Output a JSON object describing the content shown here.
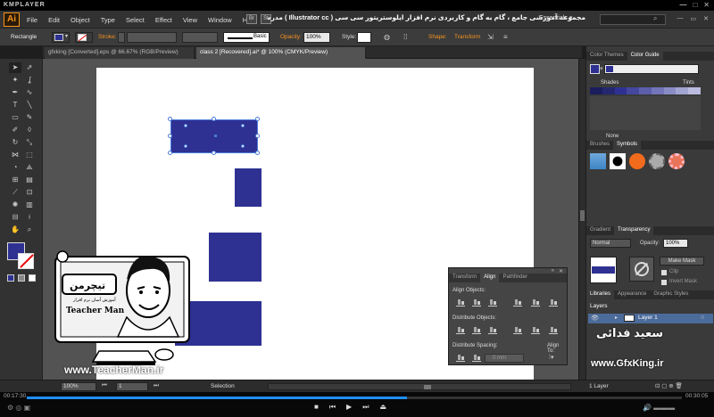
{
  "player": {
    "brand": "KMPLAYER",
    "time_current": "00:17:30",
    "time_total": "00:30:05",
    "progress": 0.58
  },
  "app": {
    "logo": "Ai",
    "menu": [
      "File",
      "Edit",
      "Object",
      "Type",
      "Select",
      "Effect",
      "View",
      "Window",
      "Help"
    ],
    "menu_icons": [
      "Br",
      "St"
    ]
  },
  "course_title": "مجموعه آموزشی جامع ، گام به گام و کاربردی نرم افزار ایلوستریتور سی سی ( Illustrator cc )  مدرس : سعید فدایی ( تیچرمن ) گروه آموزشی پادشاه گرافیست ها",
  "workspace": "Essentials",
  "control": {
    "object_type": "Rectangle",
    "stroke_label": "Stroke:",
    "brush": "Basic",
    "opacity_label": "Opacity:",
    "opacity_value": "100%",
    "style_label": "Style:",
    "shape_label": "Shape:",
    "transform_label": "Transform"
  },
  "colors": {
    "fill": "#2e3192",
    "accent": "#f7931e",
    "selection": "#4a7bd8"
  },
  "doc_tabs": [
    {
      "label": "gfxking [Converted].eps @ 66.67% (RGB/Preview)"
    },
    {
      "label": "class 2 [Recovered].ai* @ 100% (CMYK/Preview)"
    }
  ],
  "color_panel": {
    "tabs": [
      "Color Themes",
      "Color Guide"
    ],
    "shades_label": "Shades",
    "tints_label": "Tints",
    "none_label": "None",
    "shade_colors": [
      "#1b1d5c",
      "#24276f",
      "#2e3192",
      "#44479e",
      "#5b5eab",
      "#7275b8",
      "#8a8cc5",
      "#a2a4d2",
      "#babbdf"
    ]
  },
  "symbols_panel": {
    "tabs": [
      "Brushes",
      "Symbols"
    ]
  },
  "transparency_panel": {
    "tabs": [
      "Gradient",
      "Transparency"
    ],
    "blend_mode": "Normal",
    "opacity_label": "Opacity:",
    "opacity_value": "100%",
    "make_mask": "Make Mask",
    "clip": "Clip",
    "invert_mask": "Invert Mask"
  },
  "layers_panel": {
    "tabs": [
      "Libraries",
      "Appearance",
      "Graphic Styles"
    ],
    "title": "Layers",
    "layer_name": "Layer 1",
    "layer_count": "1 Layer"
  },
  "align_panel": {
    "tabs": [
      "Transform",
      "Align",
      "Pathfinder"
    ],
    "align_objects": "Align Objects:",
    "distribute_objects": "Distribute Objects:",
    "distribute_spacing": "Distribute Spacing:",
    "align_to": "Align To:",
    "spacing_value": "0 mm"
  },
  "status": {
    "zoom": "100%",
    "artboard": "1",
    "tool": "Selection"
  },
  "overlay": {
    "brand_fa": "تیچرمن",
    "brand_fa_sub": "آموزش آسان نرم افزار",
    "brand_en": "Teacher Man",
    "url": "www.TeacherMan.ir",
    "gfx_name_fa": "سعید فدائی",
    "gfx_url": "www.GfxKing.ir"
  }
}
